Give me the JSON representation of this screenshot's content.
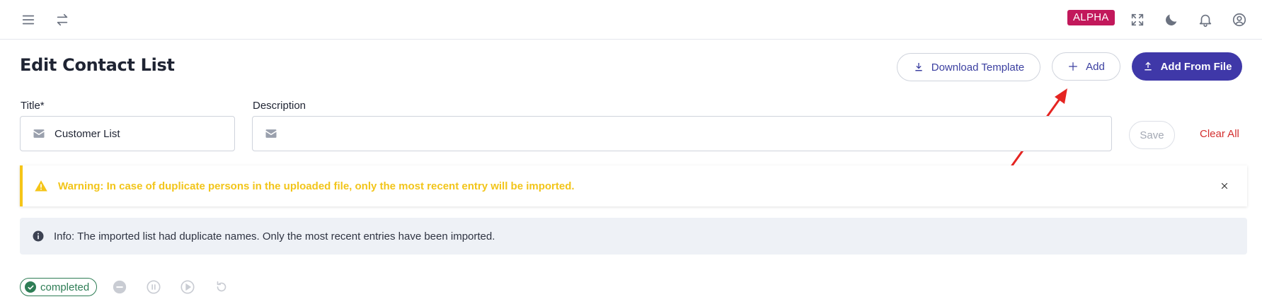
{
  "topbar": {
    "badge": "ALPHA",
    "icons": [
      "menu-icon",
      "swap-icon",
      "fullscreen-icon",
      "moon-icon",
      "bell-icon",
      "user-circle-icon"
    ]
  },
  "page": {
    "title": "Edit Contact List"
  },
  "actions": {
    "download_template": "Download Template",
    "add": "Add",
    "add_from_file": "Add From File",
    "save": "Save",
    "clear_all": "Clear All"
  },
  "form": {
    "title_label": "Title*",
    "title_value": "Customer List",
    "description_label": "Description",
    "description_value": ""
  },
  "alerts": {
    "warning": "Warning: In case of duplicate persons in the uploaded file, only the most recent entry will be imported.",
    "info": "Info: The imported list had duplicate names. Only the most recent entries have been imported."
  },
  "status": {
    "label": "completed",
    "controls": [
      "stop-icon",
      "pause-icon",
      "play-icon",
      "restart-icon"
    ]
  },
  "colors": {
    "primary": "#3f38a8",
    "alpha_badge": "#c2185b",
    "warning": "#f5c518",
    "danger": "#d32f2f",
    "success": "#2e7d55",
    "annotation_arrow": "#e52421"
  }
}
